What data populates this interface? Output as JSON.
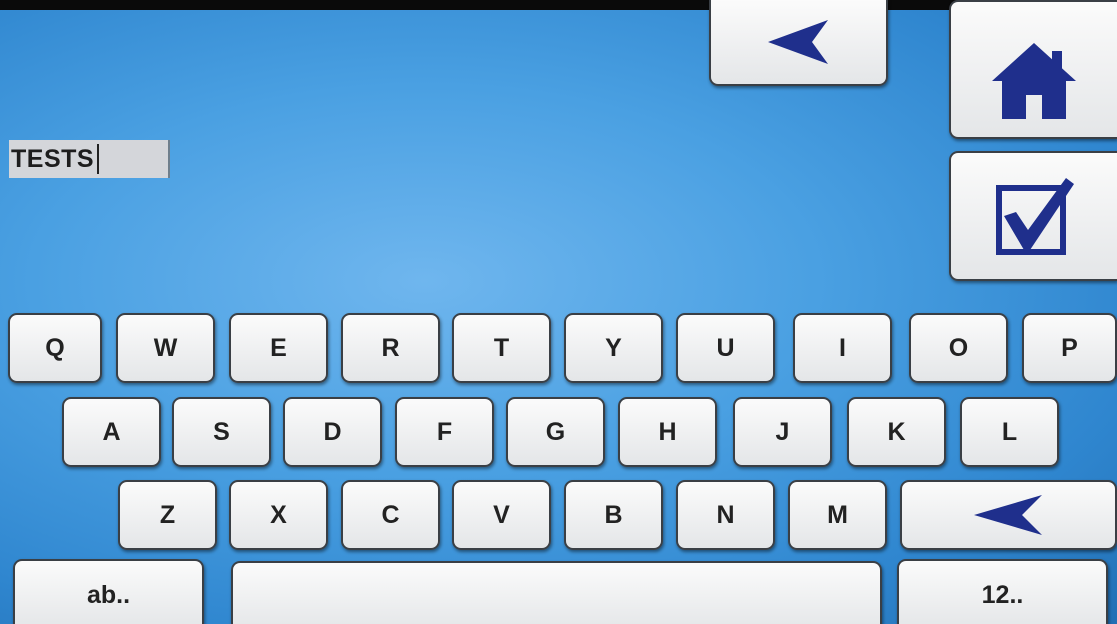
{
  "text_field": {
    "value": "TESTS"
  },
  "top_buttons": {
    "back_icon": "back-arrow-icon",
    "home_icon": "home-icon",
    "confirm_icon": "checkbox-check-icon"
  },
  "keyboard": {
    "row1": [
      "Q",
      "W",
      "E",
      "R",
      "T",
      "Y",
      "U",
      "I",
      "O",
      "P"
    ],
    "row2": [
      "A",
      "S",
      "D",
      "F",
      "G",
      "H",
      "J",
      "K",
      "L"
    ],
    "row3": [
      "Z",
      "X",
      "C",
      "V",
      "B",
      "N",
      "M"
    ],
    "backspace_icon": "backspace-arrow-icon",
    "lowercase_label": "ab..",
    "numbers_label": "12.."
  },
  "colors": {
    "background": "#4aa0e2",
    "icon_navy": "#1f2f8c",
    "key_face": "#f2f3f4"
  }
}
